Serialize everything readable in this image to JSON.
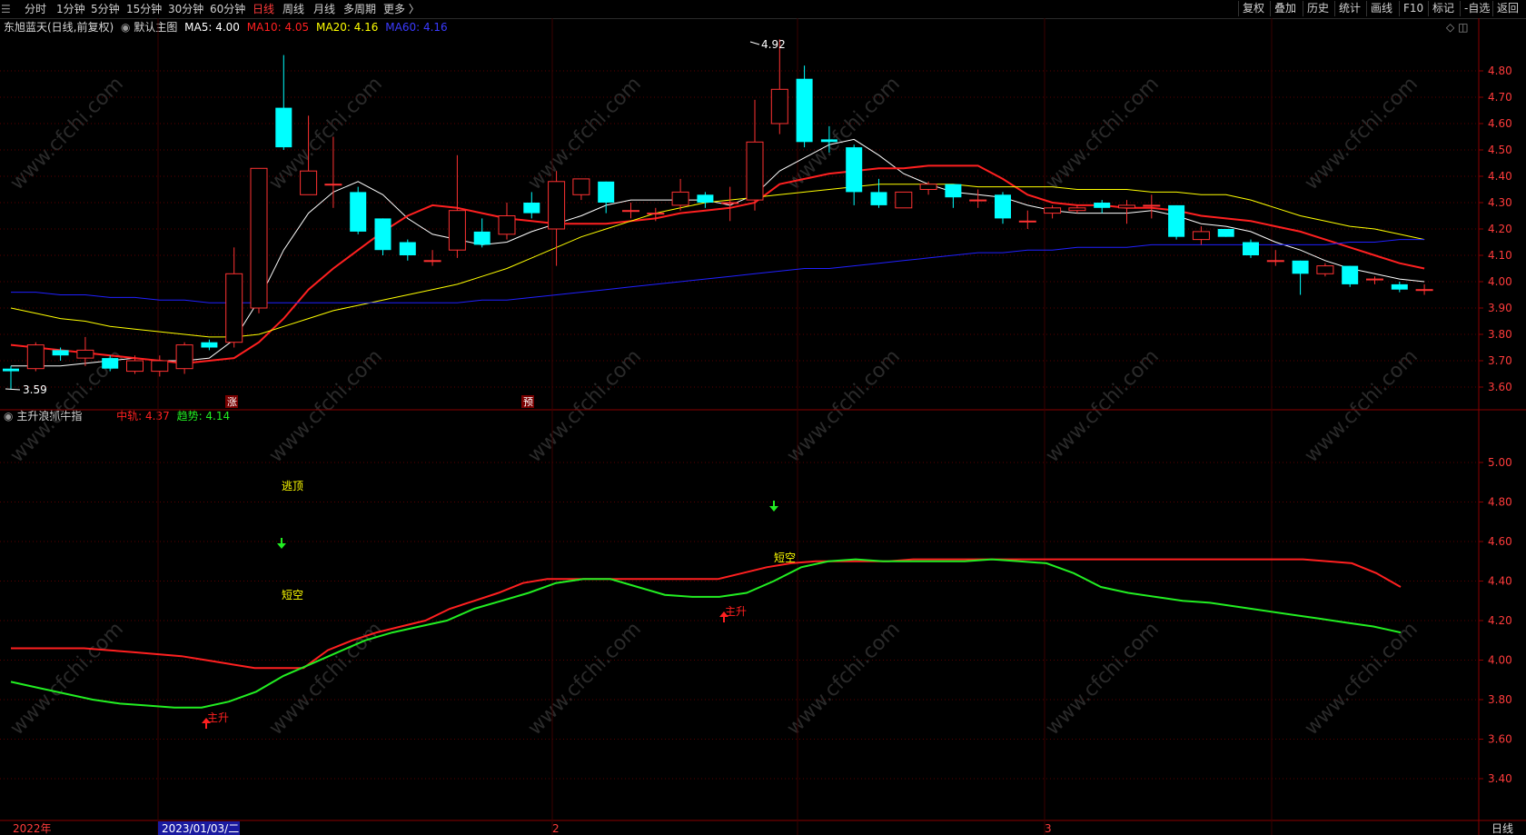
{
  "topbar": {
    "menu_label": "☰",
    "periods": [
      "分时",
      "1分钟",
      "5分钟",
      "15分钟",
      "30分钟",
      "60分钟",
      "日线",
      "周线",
      "月线",
      "多周期",
      "更多 〉"
    ],
    "active_period": "日线",
    "right_buttons": [
      "复权",
      "叠加",
      "历史",
      "统计",
      "画线",
      "F10",
      "标记",
      "-自选",
      "返回"
    ]
  },
  "main_legend": {
    "stock": "东旭蓝天(日线,前复权)",
    "chart_name": "默认主图",
    "ma5": "MA5: 4.00",
    "ma10": "MA10: 4.05",
    "ma20": "MA20: 4.16",
    "ma60": "MA60: 4.16"
  },
  "sub_legend": {
    "name": "主升浪抓牛指",
    "zhonggui": "中轨: 4.37",
    "qushi": "趋势: 4.14"
  },
  "annotations": {
    "high": "4.92",
    "low": "3.59",
    "marker_zhang": "涨",
    "marker_yu": "预",
    "taoding": "逃顶",
    "duankong": "短空",
    "zhusheng": "主升"
  },
  "bottom": {
    "year": "2022年",
    "date": "2023/01/03/二",
    "month2": "2",
    "month3": "3",
    "period": "日线"
  },
  "watermark": "www.cfchi.com",
  "colors": {
    "up": "#ff3232",
    "down": "#00ffff",
    "ma5": "#ffffff",
    "ma10": "#ff2020",
    "ma20": "#ffff00",
    "ma60": "#2020ff",
    "zhonggui": "#ff2020",
    "qushi": "#22ee22",
    "grid": "#5a0000"
  },
  "chart_data": [
    {
      "type": "candlestick",
      "title": "东旭蓝天(日线,前复权)",
      "y_ticks": [
        3.6,
        3.7,
        3.8,
        3.9,
        4.0,
        4.1,
        4.2,
        4.3,
        4.4,
        4.5,
        4.6,
        4.7,
        4.8
      ],
      "ylim": [
        3.55,
        4.95
      ],
      "candles": [
        [
          3.67,
          3.66,
          3.68,
          3.59
        ],
        [
          3.67,
          3.76,
          3.77,
          3.66
        ],
        [
          3.74,
          3.72,
          3.75,
          3.7
        ],
        [
          3.71,
          3.74,
          3.79,
          3.68
        ],
        [
          3.71,
          3.67,
          3.72,
          3.66
        ],
        [
          3.66,
          3.7,
          3.72,
          3.65
        ],
        [
          3.66,
          3.7,
          3.72,
          3.64
        ],
        [
          3.67,
          3.76,
          3.77,
          3.65
        ],
        [
          3.77,
          3.75,
          3.78,
          3.74
        ],
        [
          3.77,
          4.03,
          4.13,
          3.75
        ],
        [
          3.9,
          4.43,
          4.43,
          3.88
        ],
        [
          4.66,
          4.51,
          4.86,
          4.5
        ],
        [
          4.33,
          4.42,
          4.63,
          4.33
        ],
        [
          4.37,
          4.37,
          4.55,
          4.28
        ],
        [
          4.34,
          4.19,
          4.36,
          4.18
        ],
        [
          4.24,
          4.12,
          4.24,
          4.1
        ],
        [
          4.15,
          4.1,
          4.16,
          4.08
        ],
        [
          4.08,
          4.08,
          4.12,
          4.06
        ],
        [
          4.12,
          4.27,
          4.48,
          4.09
        ],
        [
          4.19,
          4.14,
          4.24,
          4.13
        ],
        [
          4.18,
          4.25,
          4.3,
          4.16
        ],
        [
          4.3,
          4.26,
          4.34,
          4.24
        ],
        [
          4.2,
          4.38,
          4.42,
          4.06
        ],
        [
          4.33,
          4.39,
          4.39,
          4.31
        ],
        [
          4.38,
          4.3,
          4.38,
          4.26
        ],
        [
          4.27,
          4.27,
          4.3,
          4.24
        ],
        [
          4.26,
          4.26,
          4.28,
          4.23
        ],
        [
          4.29,
          4.34,
          4.39,
          4.27
        ],
        [
          4.33,
          4.3,
          4.34,
          4.28
        ],
        [
          4.3,
          4.3,
          4.36,
          4.23
        ],
        [
          4.31,
          4.53,
          4.69,
          4.27
        ],
        [
          4.6,
          4.73,
          4.92,
          4.56
        ],
        [
          4.77,
          4.53,
          4.82,
          4.51
        ],
        [
          4.54,
          4.53,
          4.59,
          4.49
        ],
        [
          4.51,
          4.34,
          4.52,
          4.29
        ],
        [
          4.34,
          4.29,
          4.39,
          4.28
        ],
        [
          4.28,
          4.34,
          4.34,
          4.28
        ],
        [
          4.35,
          4.37,
          4.38,
          4.33
        ],
        [
          4.37,
          4.32,
          4.37,
          4.28
        ],
        [
          4.31,
          4.31,
          4.35,
          4.28
        ],
        [
          4.33,
          4.24,
          4.34,
          4.22
        ],
        [
          4.23,
          4.23,
          4.27,
          4.2
        ],
        [
          4.26,
          4.28,
          4.29,
          4.24
        ],
        [
          4.27,
          4.28,
          4.29,
          4.26
        ],
        [
          4.3,
          4.28,
          4.31,
          4.26
        ],
        [
          4.28,
          4.29,
          4.31,
          4.22
        ],
        [
          4.29,
          4.29,
          4.33,
          4.24
        ],
        [
          4.29,
          4.17,
          4.29,
          4.16
        ],
        [
          4.16,
          4.19,
          4.21,
          4.14
        ],
        [
          4.2,
          4.17,
          4.2,
          4.17
        ],
        [
          4.15,
          4.1,
          4.16,
          4.09
        ],
        [
          4.08,
          4.08,
          4.12,
          4.06
        ],
        [
          4.08,
          4.03,
          4.08,
          3.95
        ],
        [
          4.03,
          4.06,
          4.07,
          4.02
        ],
        [
          4.06,
          3.99,
          4.06,
          3.98
        ],
        [
          4.01,
          4.01,
          4.02,
          3.99
        ],
        [
          3.99,
          3.97,
          4.0,
          3.96
        ],
        [
          3.97,
          3.97,
          3.99,
          3.95
        ]
      ],
      "series": [
        {
          "name": "MA5",
          "values": [
            3.68,
            3.68,
            3.68,
            3.69,
            3.7,
            3.71,
            3.7,
            3.7,
            3.71,
            3.78,
            3.93,
            4.12,
            4.26,
            4.34,
            4.38,
            4.33,
            4.24,
            4.18,
            4.16,
            4.14,
            4.15,
            4.19,
            4.22,
            4.25,
            4.29,
            4.31,
            4.31,
            4.31,
            4.31,
            4.29,
            4.33,
            4.42,
            4.47,
            4.52,
            4.54,
            4.48,
            4.41,
            4.37,
            4.34,
            4.33,
            4.32,
            4.29,
            4.27,
            4.26,
            4.26,
            4.26,
            4.27,
            4.25,
            4.22,
            4.21,
            4.19,
            4.15,
            4.12,
            4.08,
            4.05,
            4.03,
            4.01,
            4.0
          ]
        },
        {
          "name": "MA10",
          "values": [
            3.76,
            3.75,
            3.74,
            3.73,
            3.72,
            3.71,
            3.7,
            3.69,
            3.7,
            3.71,
            3.77,
            3.86,
            3.97,
            4.05,
            4.12,
            4.19,
            4.25,
            4.29,
            4.28,
            4.26,
            4.24,
            4.23,
            4.22,
            4.22,
            4.22,
            4.23,
            4.24,
            4.26,
            4.27,
            4.28,
            4.3,
            4.37,
            4.39,
            4.41,
            4.42,
            4.43,
            4.43,
            4.44,
            4.44,
            4.44,
            4.39,
            4.33,
            4.3,
            4.29,
            4.29,
            4.28,
            4.28,
            4.27,
            4.25,
            4.24,
            4.23,
            4.21,
            4.19,
            4.16,
            4.13,
            4.1,
            4.07,
            4.05
          ]
        },
        {
          "name": "MA20",
          "values": [
            3.9,
            3.88,
            3.86,
            3.85,
            3.83,
            3.82,
            3.81,
            3.8,
            3.79,
            3.79,
            3.8,
            3.83,
            3.86,
            3.89,
            3.91,
            3.93,
            3.95,
            3.97,
            3.99,
            4.02,
            4.05,
            4.09,
            4.13,
            4.17,
            4.2,
            4.23,
            4.26,
            4.28,
            4.3,
            4.31,
            4.32,
            4.33,
            4.34,
            4.35,
            4.36,
            4.37,
            4.37,
            4.37,
            4.37,
            4.36,
            4.36,
            4.36,
            4.36,
            4.35,
            4.35,
            4.35,
            4.34,
            4.34,
            4.33,
            4.33,
            4.31,
            4.28,
            4.25,
            4.23,
            4.21,
            4.2,
            4.18,
            4.16
          ]
        },
        {
          "name": "MA60",
          "values": [
            3.96,
            3.96,
            3.95,
            3.95,
            3.94,
            3.94,
            3.93,
            3.93,
            3.92,
            3.92,
            3.92,
            3.92,
            3.92,
            3.92,
            3.92,
            3.92,
            3.92,
            3.92,
            3.92,
            3.93,
            3.93,
            3.94,
            3.95,
            3.96,
            3.97,
            3.98,
            3.99,
            4.0,
            4.01,
            4.02,
            4.03,
            4.04,
            4.05,
            4.05,
            4.06,
            4.07,
            4.08,
            4.09,
            4.1,
            4.11,
            4.11,
            4.12,
            4.12,
            4.13,
            4.13,
            4.13,
            4.14,
            4.14,
            4.14,
            4.14,
            4.14,
            4.14,
            4.14,
            4.14,
            4.15,
            4.15,
            4.16,
            4.16
          ]
        }
      ]
    },
    {
      "type": "line",
      "title": "主升浪抓牛指",
      "y_ticks": [
        3.4,
        3.6,
        3.8,
        4.0,
        4.2,
        4.4,
        4.6,
        4.8,
        5.0
      ],
      "ylim": [
        3.22,
        5.22
      ],
      "series": [
        {
          "name": "中轨",
          "values": [
            4.06,
            4.06,
            4.06,
            4.06,
            4.05,
            4.04,
            4.03,
            4.02,
            4.0,
            3.98,
            3.96,
            3.96,
            3.96,
            4.05,
            4.1,
            4.14,
            4.17,
            4.2,
            4.26,
            4.3,
            4.34,
            4.39,
            4.41,
            4.41,
            4.41,
            4.41,
            4.41,
            4.41,
            4.41,
            4.41,
            4.44,
            4.47,
            4.49,
            4.5,
            4.5,
            4.5,
            4.5,
            4.51,
            4.51,
            4.51,
            4.51,
            4.51,
            4.51,
            4.51,
            4.51,
            4.51,
            4.51,
            4.51,
            4.51,
            4.51,
            4.51,
            4.51,
            4.51,
            4.51,
            4.5,
            4.49,
            4.44,
            4.37
          ]
        },
        {
          "name": "趋势",
          "values": [
            3.89,
            3.86,
            3.83,
            3.8,
            3.78,
            3.77,
            3.76,
            3.76,
            3.79,
            3.84,
            3.92,
            3.98,
            4.04,
            4.1,
            4.14,
            4.17,
            4.2,
            4.26,
            4.3,
            4.34,
            4.39,
            4.41,
            4.41,
            4.37,
            4.33,
            4.32,
            4.32,
            4.34,
            4.4,
            4.47,
            4.5,
            4.51,
            4.5,
            4.5,
            4.5,
            4.5,
            4.51,
            4.5,
            4.49,
            4.44,
            4.37,
            4.34,
            4.32,
            4.3,
            4.29,
            4.27,
            4.25,
            4.23,
            4.21,
            4.19,
            4.17,
            4.14
          ]
        }
      ]
    }
  ]
}
